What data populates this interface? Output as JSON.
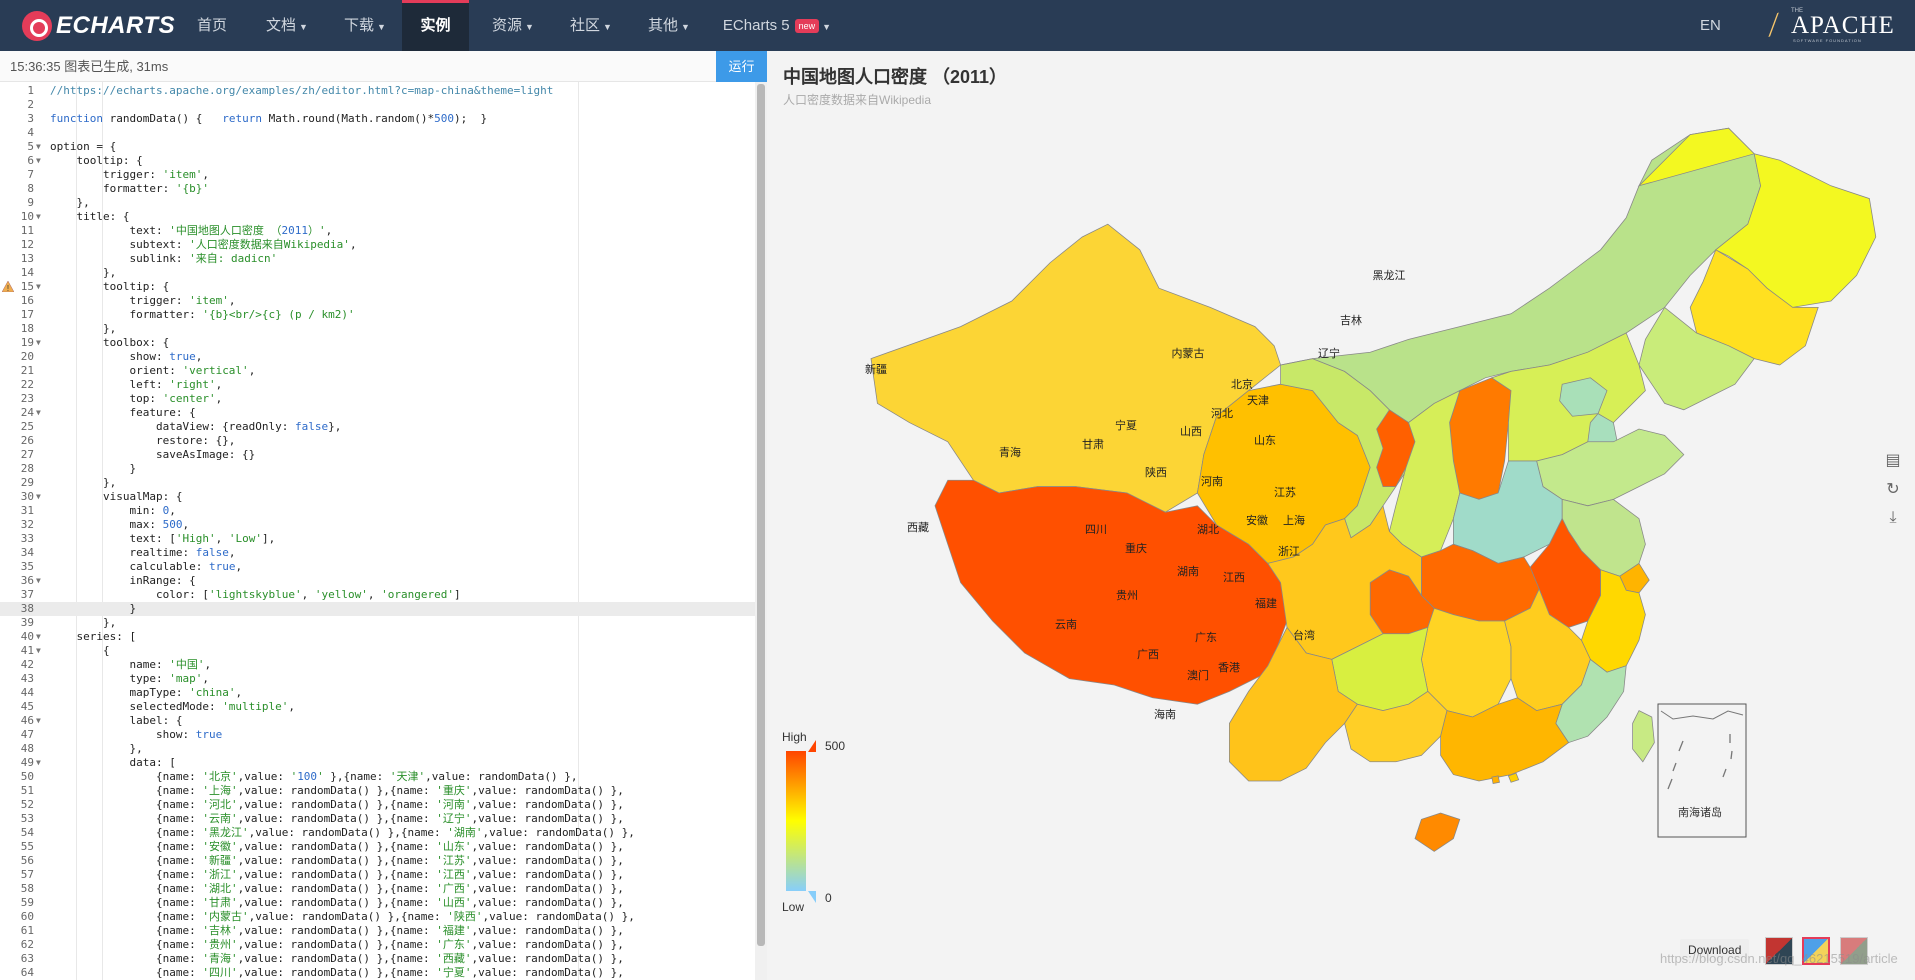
{
  "nav": {
    "logo_text": "ECHARTS",
    "items": [
      "首页",
      "文档",
      "下载",
      "实例",
      "资源",
      "社区",
      "其他"
    ],
    "echarts5": "ECharts 5",
    "new_badge": "new",
    "lang": "EN",
    "apache_the": "THE",
    "apache_word": "APACHE",
    "apache_sub": "SOFTWARE FOUNDATION"
  },
  "editor": {
    "status": "15:36:35  图表已生成, 31ms",
    "run_label": "运行",
    "lines": [
      {
        "n": "1",
        "t": "//https://echarts.apache.org/examples/zh/editor.html?c=map-china&theme=light"
      },
      {
        "n": "2",
        "t": ""
      },
      {
        "n": "3",
        "t": "function randomData() {   return Math.round(Math.random()*500);  }"
      },
      {
        "n": "4",
        "t": ""
      },
      {
        "n": "5",
        "t": "option = {",
        "fold": "true"
      },
      {
        "n": "6",
        "t": "    tooltip: {",
        "fold": "true"
      },
      {
        "n": "7",
        "t": "        trigger: 'item',"
      },
      {
        "n": "8",
        "t": "        formatter: '{b}'"
      },
      {
        "n": "9",
        "t": "    },"
      },
      {
        "n": "10",
        "t": "    title: {",
        "fold": "true"
      },
      {
        "n": "11",
        "t": "            text: '中国地图人口密度 （2011）',"
      },
      {
        "n": "12",
        "t": "            subtext: '人口密度数据来自Wikipedia',"
      },
      {
        "n": "13",
        "t": "            sublink: '来自: dadicn'"
      },
      {
        "n": "14",
        "t": "        },"
      },
      {
        "n": "15",
        "t": "        tooltip: {",
        "fold": "true",
        "warn": "true"
      },
      {
        "n": "16",
        "t": "            trigger: 'item',"
      },
      {
        "n": "17",
        "t": "            formatter: '{b}<br/>{c} (p / km2)'"
      },
      {
        "n": "18",
        "t": "        },"
      },
      {
        "n": "19",
        "t": "        toolbox: {",
        "fold": "true"
      },
      {
        "n": "20",
        "t": "            show: true,"
      },
      {
        "n": "21",
        "t": "            orient: 'vertical',"
      },
      {
        "n": "22",
        "t": "            left: 'right',"
      },
      {
        "n": "23",
        "t": "            top: 'center',"
      },
      {
        "n": "24",
        "t": "            feature: {",
        "fold": "true"
      },
      {
        "n": "25",
        "t": "                dataView: {readOnly: false},"
      },
      {
        "n": "26",
        "t": "                restore: {},"
      },
      {
        "n": "27",
        "t": "                saveAsImage: {}"
      },
      {
        "n": "28",
        "t": "            }"
      },
      {
        "n": "29",
        "t": "        },"
      },
      {
        "n": "30",
        "t": "        visualMap: {",
        "fold": "true"
      },
      {
        "n": "31",
        "t": "            min: 0,"
      },
      {
        "n": "32",
        "t": "            max: 500,"
      },
      {
        "n": "33",
        "t": "            text: ['High', 'Low'],"
      },
      {
        "n": "34",
        "t": "            realtime: false,"
      },
      {
        "n": "35",
        "t": "            calculable: true,"
      },
      {
        "n": "36",
        "t": "            inRange: {",
        "fold": "true"
      },
      {
        "n": "37",
        "t": "                color: ['lightskyblue', 'yellow', 'orangered']"
      },
      {
        "n": "38",
        "t": "            }",
        "hl": "true"
      },
      {
        "n": "39",
        "t": "        },"
      },
      {
        "n": "40",
        "t": "    series: [",
        "fold": "true"
      },
      {
        "n": "41",
        "t": "        {",
        "fold": "true"
      },
      {
        "n": "42",
        "t": "            name: '中国',"
      },
      {
        "n": "43",
        "t": "            type: 'map',"
      },
      {
        "n": "44",
        "t": "            mapType: 'china',"
      },
      {
        "n": "45",
        "t": "            selectedMode: 'multiple',"
      },
      {
        "n": "46",
        "t": "            label: {",
        "fold": "true"
      },
      {
        "n": "47",
        "t": "                show: true"
      },
      {
        "n": "48",
        "t": "            },"
      },
      {
        "n": "49",
        "t": "            data: [",
        "fold": "true"
      },
      {
        "n": "50",
        "t": "                {name: '北京',value: '100' },{name: '天津',value: randomData() },"
      },
      {
        "n": "51",
        "t": "                {name: '上海',value: randomData() },{name: '重庆',value: randomData() },"
      },
      {
        "n": "52",
        "t": "                {name: '河北',value: randomData() },{name: '河南',value: randomData() },"
      },
      {
        "n": "53",
        "t": "                {name: '云南',value: randomData() },{name: '辽宁',value: randomData() },"
      },
      {
        "n": "54",
        "t": "                {name: '黑龙江',value: randomData() },{name: '湖南',value: randomData() },"
      },
      {
        "n": "55",
        "t": "                {name: '安徽',value: randomData() },{name: '山东',value: randomData() },"
      },
      {
        "n": "56",
        "t": "                {name: '新疆',value: randomData() },{name: '江苏',value: randomData() },"
      },
      {
        "n": "57",
        "t": "                {name: '浙江',value: randomData() },{name: '江西',value: randomData() },"
      },
      {
        "n": "58",
        "t": "                {name: '湖北',value: randomData() },{name: '广西',value: randomData() },"
      },
      {
        "n": "59",
        "t": "                {name: '甘肃',value: randomData() },{name: '山西',value: randomData() },"
      },
      {
        "n": "60",
        "t": "                {name: '内蒙古',value: randomData() },{name: '陕西',value: randomData() },"
      },
      {
        "n": "61",
        "t": "                {name: '吉林',value: randomData() },{name: '福建',value: randomData() },"
      },
      {
        "n": "62",
        "t": "                {name: '贵州',value: randomData() },{name: '广东',value: randomData() },"
      },
      {
        "n": "63",
        "t": "                {name: '青海',value: randomData() },{name: '西藏',value: randomData() },"
      },
      {
        "n": "64",
        "t": "                {name: '四川',value: randomData() },{name: '宁夏',value: randomData() },"
      }
    ]
  },
  "chart": {
    "title": "中国地图人口密度 （2011）",
    "subtitle": "人口密度数据来自Wikipedia",
    "visual_map": {
      "high_label": "High",
      "low_label": "Low",
      "max": "500",
      "min": "0",
      "colors": [
        "#87cefa",
        "#ffff00",
        "#ff4500"
      ]
    },
    "inset_label": "南海诸岛",
    "download_label": "Download",
    "watermark": "https://blog.csdn.net/qq_46215519/article",
    "toolbox_icons": [
      "data-view-icon",
      "restore-icon",
      "save-as-image-icon"
    ],
    "provinces": [
      {
        "name": "新疆",
        "color": "#fcd535"
      },
      {
        "name": "西藏",
        "color": "#ff5000"
      },
      {
        "name": "青海",
        "color": "#ffc000"
      },
      {
        "name": "甘肃",
        "color": "#c8e868"
      },
      {
        "name": "内蒙古",
        "color": "#b9e28a"
      },
      {
        "name": "黑龙江",
        "color": "#f3f821"
      },
      {
        "name": "吉林",
        "color": "#ffe020"
      },
      {
        "name": "辽宁",
        "color": "#c9ec7a"
      },
      {
        "name": "宁夏",
        "color": "#ff6000"
      },
      {
        "name": "山西",
        "color": "#ff7a00"
      },
      {
        "name": "河北",
        "color": "#d7ef56"
      },
      {
        "name": "北京",
        "color": "#a9e0b8"
      },
      {
        "name": "天津",
        "color": "#a8dfbd"
      },
      {
        "name": "山东",
        "color": "#c3e98c"
      },
      {
        "name": "陕西",
        "color": "#d6ee58"
      },
      {
        "name": "河南",
        "color": "#a0dbc9"
      },
      {
        "name": "江苏",
        "color": "#c0e48d"
      },
      {
        "name": "安徽",
        "color": "#ff5600"
      },
      {
        "name": "上海",
        "color": "#ffb400"
      },
      {
        "name": "浙江",
        "color": "#ffd800"
      },
      {
        "name": "湖北",
        "color": "#ff6a00"
      },
      {
        "name": "重庆",
        "color": "#ff6800"
      },
      {
        "name": "四川",
        "color": "#ffc81c"
      },
      {
        "name": "湖南",
        "color": "#ffd424"
      },
      {
        "name": "江西",
        "color": "#ffcd1e"
      },
      {
        "name": "贵州",
        "color": "#d8ef40"
      },
      {
        "name": "福建",
        "color": "#b0e2b0"
      },
      {
        "name": "云南",
        "color": "#ffc31a"
      },
      {
        "name": "广西",
        "color": "#ffcf26"
      },
      {
        "name": "广东",
        "color": "#ffb600"
      },
      {
        "name": "台湾",
        "color": "#c8ea84"
      },
      {
        "name": "海南",
        "color": "#ff8a00"
      },
      {
        "name": "香港",
        "color": "#ffd000"
      },
      {
        "name": "澳门",
        "color": "#ffb000"
      }
    ]
  }
}
